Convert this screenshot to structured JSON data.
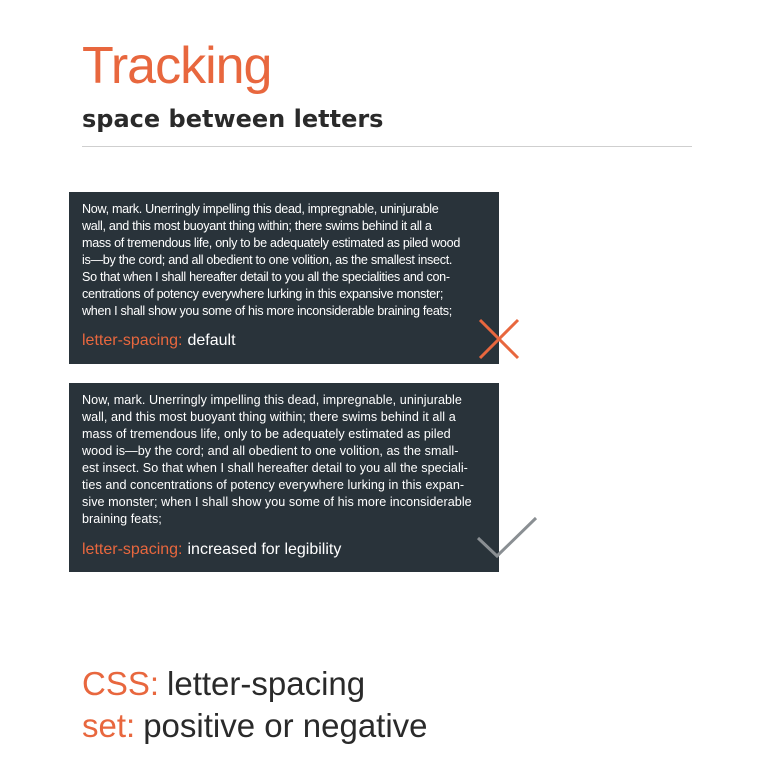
{
  "header": {
    "title": "Tracking",
    "subtitle": "space between letters"
  },
  "examples": [
    {
      "lines": [
        "Now, mark. Unerringly impelling this dead, impregnable, uninjurable",
        "wall, and this most buoyant thing within; there swims behind it all a",
        "mass of tremendous life, only to be adequately estimated as piled wood",
        "is—by the cord; and all obedient to one volition, as the smallest insect.",
        "So that when I shall hereafter detail to you all the specialities and con-",
        "centrations of potency everywhere lurking in this expansive monster;",
        "when I shall show you some of his more inconsiderable braining feats;"
      ],
      "caption_key": "letter-spacing:",
      "caption_value": "default",
      "verdict_icon": "cross-icon",
      "verdict_color": "#e8673e"
    },
    {
      "lines": [
        "Now, mark. Unerringly impelling this dead, impregnable, uninjurable",
        "wall, and this most buoyant thing within; there swims behind it all a",
        "mass of tremendous life, only to be adequately estimated as piled",
        "wood is—by the cord; and all obedient to one volition, as the small-",
        "est insect. So that when I shall hereafter detail to you all the speciali-",
        "ties and concentrations of potency everywhere lurking in this expan-",
        "sive monster; when I shall show you some of his more inconsiderable",
        "braining feats;"
      ],
      "caption_key": "letter-spacing:",
      "caption_value": "increased for legibility",
      "verdict_icon": "check-icon",
      "verdict_color": "#8a8f93"
    }
  ],
  "footer": {
    "css_key": "CSS:",
    "css_value": "letter-spacing",
    "set_key": "set:",
    "set_value": "positive or negative"
  },
  "colors": {
    "accent": "#e8673e",
    "panel_bg": "#29333a",
    "heading_dark": "#2a2a2a"
  }
}
